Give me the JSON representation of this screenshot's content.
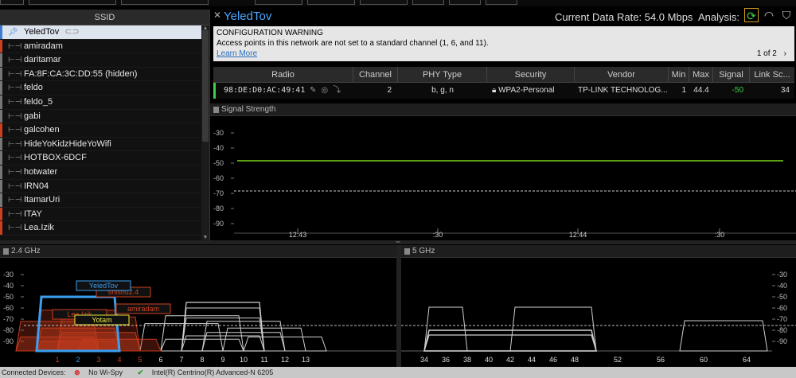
{
  "ssid_panel": {
    "header": "SSID",
    "items": [
      {
        "name": "YeledTov",
        "color": "#3a7bd5",
        "selected": true
      },
      {
        "name": "amiradam",
        "color": "#d04020"
      },
      {
        "name": "daritamar",
        "color": "#777777"
      },
      {
        "name": "FA:8F:CA:3C:DD:55 (hidden)",
        "color": "#777777"
      },
      {
        "name": "feldo",
        "color": "#777777"
      },
      {
        "name": "feldo_5",
        "color": "#777777"
      },
      {
        "name": "gabi",
        "color": "#777777"
      },
      {
        "name": "galcohen",
        "color": "#d04020"
      },
      {
        "name": "HideYoKidzHideYoWifi",
        "color": "#777777"
      },
      {
        "name": "HOTBOX-6DCF",
        "color": "#777777"
      },
      {
        "name": "hotwater",
        "color": "#777777"
      },
      {
        "name": "IRN04",
        "color": "#777777"
      },
      {
        "name": "ItamarUri",
        "color": "#777777"
      },
      {
        "name": "ITAY",
        "color": "#d04020"
      },
      {
        "name": "Lea.Izik",
        "color": "#d04020"
      }
    ]
  },
  "header": {
    "close": "✕",
    "network": "YeledTov",
    "rate_label": "Current Data Rate: 54.0 Mbps",
    "analysis_label": "Analysis:"
  },
  "warning": {
    "title": "CONFIGURATION WARNING",
    "text": "Access points in this network are not set to a standard channel (1, 6, and 11).",
    "link": "Learn More",
    "pager": "1 of 2",
    "pager_arrow": "›"
  },
  "table": {
    "columns": [
      "Radio",
      "Channel",
      "PHY Type",
      "Security",
      "Vendor",
      "Min",
      "Max",
      "Signal",
      "Link Sc..."
    ],
    "row": {
      "radio": "98:DE:D0:AC:49:41",
      "channel": "2",
      "phy": "b, g, n",
      "security": "WPA2-Personal",
      "vendor": "TP-LINK TECHNOLOG...",
      "min": "1",
      "max": "44.4",
      "signal": "-50",
      "link": "34"
    }
  },
  "signal_panel": {
    "title": "Signal Strength",
    "y_ticks": [
      "-30",
      "-40",
      "-50",
      "-60",
      "-70",
      "-80",
      "-90"
    ],
    "x_ticks": [
      "12:43",
      ":30",
      "12:44",
      ":30"
    ]
  },
  "band24": {
    "title": "2.4 GHz",
    "y_ticks": [
      "-30",
      "-40",
      "-50",
      "-60",
      "-70",
      "-80",
      "-90"
    ],
    "channels": [
      "1",
      "2",
      "3",
      "4",
      "5",
      "6",
      "7",
      "8",
      "9",
      "10",
      "11",
      "12",
      "13"
    ],
    "labels": {
      "yeledtov": "YeledTov",
      "shishu": "shishu2.4",
      "amiradam": "amiradam",
      "leaizik": "Lea.Izik",
      "yotam": "Yotam"
    }
  },
  "band5": {
    "title": "5 GHz",
    "y_ticks": [
      "-30",
      "-40",
      "-50",
      "-60",
      "-70",
      "-80",
      "-90"
    ],
    "channels": [
      "34",
      "36",
      "38",
      "40",
      "42",
      "44",
      "46",
      "48",
      "52",
      "56",
      "60",
      "64"
    ]
  },
  "statusbar": {
    "label": "Connected Devices:",
    "dev1": "No Wi-Spy",
    "dev2": "Intel(R) Centrino(R) Advanced-N 6205"
  },
  "colors": {
    "accent": "#4aa8ff",
    "signal_line": "#7ed321",
    "warning_bg": "#e6e6e6",
    "selected_row": "#dde4ee",
    "connected_band": "#3a9ff0"
  }
}
